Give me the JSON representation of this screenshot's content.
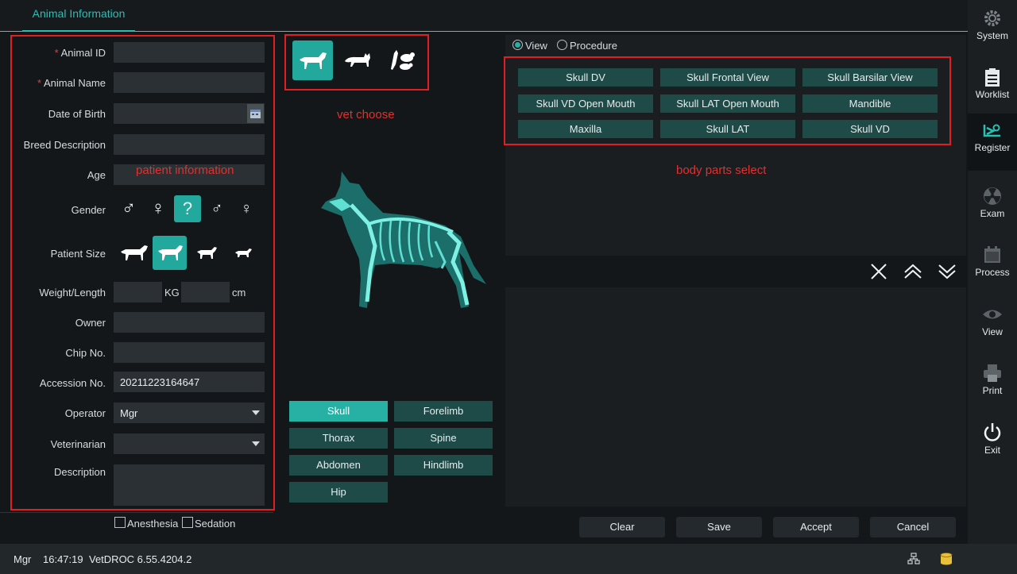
{
  "header": {
    "tab_label": "Animal Information"
  },
  "sidebar": {
    "items": [
      {
        "label": "System",
        "icon": "gear-icon"
      },
      {
        "label": "Worklist",
        "icon": "clipboard-icon"
      },
      {
        "label": "Register",
        "icon": "register-icon"
      },
      {
        "label": "Exam",
        "icon": "radiation-icon"
      },
      {
        "label": "Process",
        "icon": "process-icon"
      },
      {
        "label": "View",
        "icon": "eye-icon"
      },
      {
        "label": "Print",
        "icon": "printer-icon"
      },
      {
        "label": "Exit",
        "icon": "power-icon"
      }
    ],
    "active": "Register"
  },
  "form": {
    "required_mark": "*",
    "animal_id": {
      "label": "Animal ID",
      "value": ""
    },
    "animal_name": {
      "label": "Animal Name",
      "value": ""
    },
    "date_of_birth": {
      "label": "Date of Birth",
      "value": ""
    },
    "breed_description": {
      "label": "Breed Description",
      "value": ""
    },
    "age": {
      "label": "Age",
      "value": ""
    },
    "gender": {
      "label": "Gender",
      "options": [
        "♂",
        "♀",
        "?",
        "♂",
        "♀"
      ],
      "selected_index": 2
    },
    "patient_size": {
      "label": "Patient Size",
      "selected_index": 1
    },
    "weight_length": {
      "label": "Weight/Length",
      "weight": "",
      "weight_unit": "KG",
      "length": "",
      "length_unit": "cm"
    },
    "owner": {
      "label": "Owner",
      "value": ""
    },
    "chip_no": {
      "label": "Chip No.",
      "value": ""
    },
    "accession_no": {
      "label": "Accession No.",
      "value": "20211223164647"
    },
    "operator": {
      "label": "Operator",
      "value": "Mgr"
    },
    "veterinarian": {
      "label": "Veterinarian",
      "value": ""
    },
    "description": {
      "label": "Description",
      "value": ""
    },
    "anesthesia": "Anesthesia",
    "sedation": "Sedation"
  },
  "annotations": {
    "patient_information": "patient information",
    "vet_choose": "vet choose",
    "body_parts_select": "body parts select"
  },
  "species": {
    "selected": "dog",
    "options": [
      "dog",
      "cat",
      "bird-rodent"
    ]
  },
  "categories": [
    {
      "label": "Skull",
      "selected": true
    },
    {
      "label": "Forelimb",
      "selected": false
    },
    {
      "label": "Thorax",
      "selected": false
    },
    {
      "label": "Spine",
      "selected": false
    },
    {
      "label": "Abdomen",
      "selected": false
    },
    {
      "label": "Hindlimb",
      "selected": false
    },
    {
      "label": "Hip",
      "selected": false
    }
  ],
  "mode": {
    "view_label": "View",
    "procedure_label": "Procedure",
    "selected": "View"
  },
  "body_parts": [
    "Skull DV",
    "Skull Frontal View",
    "Skull Barsilar View",
    "Skull VD Open Mouth",
    "Skull LAT Open Mouth",
    "Mandible",
    "Maxilla",
    "Skull LAT",
    "Skull VD"
  ],
  "actions": {
    "clear": "Clear",
    "save": "Save",
    "accept": "Accept",
    "cancel": "Cancel"
  },
  "status": {
    "user": "Mgr",
    "time": "16:47:19",
    "version": "VetDROC 6.55.4204.2"
  },
  "colors": {
    "accent": "#27b1a4",
    "annotation": "#e02020",
    "background": "#141719"
  }
}
